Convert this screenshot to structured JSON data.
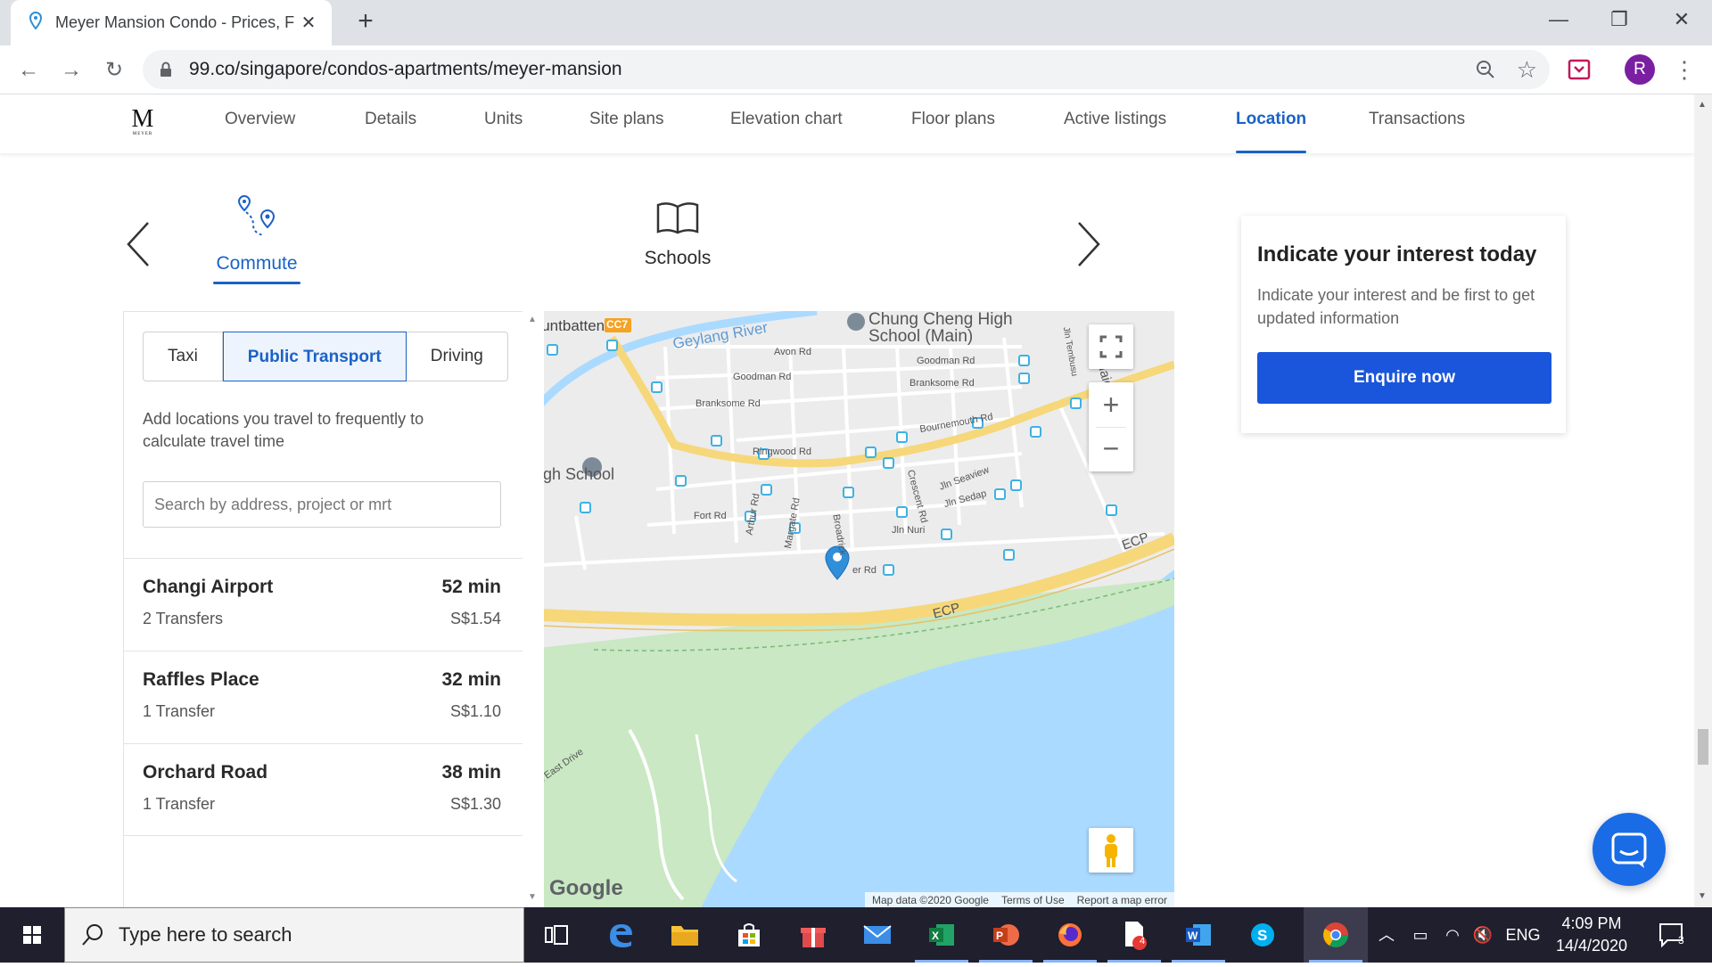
{
  "browser": {
    "tab_title": "Meyer Mansion Condo - Prices, F",
    "url": "99.co/singapore/condos-apartments/meyer-mansion",
    "avatar_letter": "R"
  },
  "subnav": {
    "logo": "M",
    "logo_subtext": "MEYER",
    "links": [
      "Overview",
      "Details",
      "Units",
      "Site plans",
      "Elevation chart",
      "Floor plans",
      "Active listings",
      "Location",
      "Transactions"
    ],
    "active": "Location"
  },
  "categories": {
    "commute": "Commute",
    "schools": "Schools"
  },
  "commute": {
    "modes": [
      "Taxi",
      "Public Transport",
      "Driving"
    ],
    "active_mode": "Public Transport",
    "help_text": "Add locations you travel to frequently to calculate travel time",
    "search_placeholder": "Search by address, project or mrt",
    "destinations": [
      {
        "name": "Changi Airport",
        "transfers": "2 Transfers",
        "time": "52 min",
        "price": "S$1.54"
      },
      {
        "name": "Raffles Place",
        "transfers": "1 Transfer",
        "time": "32 min",
        "price": "S$1.10"
      },
      {
        "name": "Orchard Road",
        "transfers": "1 Transfer",
        "time": "38 min",
        "price": "S$1.30"
      }
    ]
  },
  "map": {
    "labels": {
      "school": "Chung Cheng High School (Main)",
      "high_school": "High School",
      "river": "Geylang River",
      "station": "CC7",
      "mountbatten": "lountbatten",
      "ecp1": "ECP",
      "ecp2": "ECP",
      "marina": "arina East Drive",
      "avon": "Avon Rd",
      "goodman1": "Goodman Rd",
      "goodman2": "Goodman Rd",
      "branksome1": "Branksome Rd",
      "branksome2": "Branksome Rd",
      "bournemouth": "Bournemouth Rd",
      "ringwood": "Ringwood Rd",
      "fort": "Fort Rd",
      "arthur": "Arthur Rd",
      "margate": "Margate Rd",
      "broadrick": "Broadrick",
      "crescent": "Crescent Rd",
      "seaview": "Jln Seaview",
      "sedap": "Jln Sedap",
      "nuri": "Jln Nuri",
      "meyer": "er Rd",
      "haig": "Haig R",
      "tembusu": "Jln Tembusu",
      "road_d": "d)"
    },
    "google": "Google",
    "footer": [
      "Map data ©2020 Google",
      "Terms of Use",
      "Report a map error"
    ],
    "colors": {
      "land": "#ececec",
      "water": "#aadaff",
      "park": "#c9e8c3",
      "highway": "#f6d77a",
      "transit": "#3eb1e3",
      "marker": "#2f8fd8"
    }
  },
  "interest": {
    "title": "Indicate your interest today",
    "text": "Indicate your interest and be first to get updated information",
    "button": "Enquire now"
  },
  "taskbar": {
    "search_placeholder": "Type here to search",
    "tray_lang": "ENG",
    "time": "4:09 PM",
    "date": "14/4/2020",
    "notification_count": "3",
    "pdf_badge": "4"
  },
  "colors": {
    "accent": "#1a62c7",
    "button": "#1a56db"
  }
}
